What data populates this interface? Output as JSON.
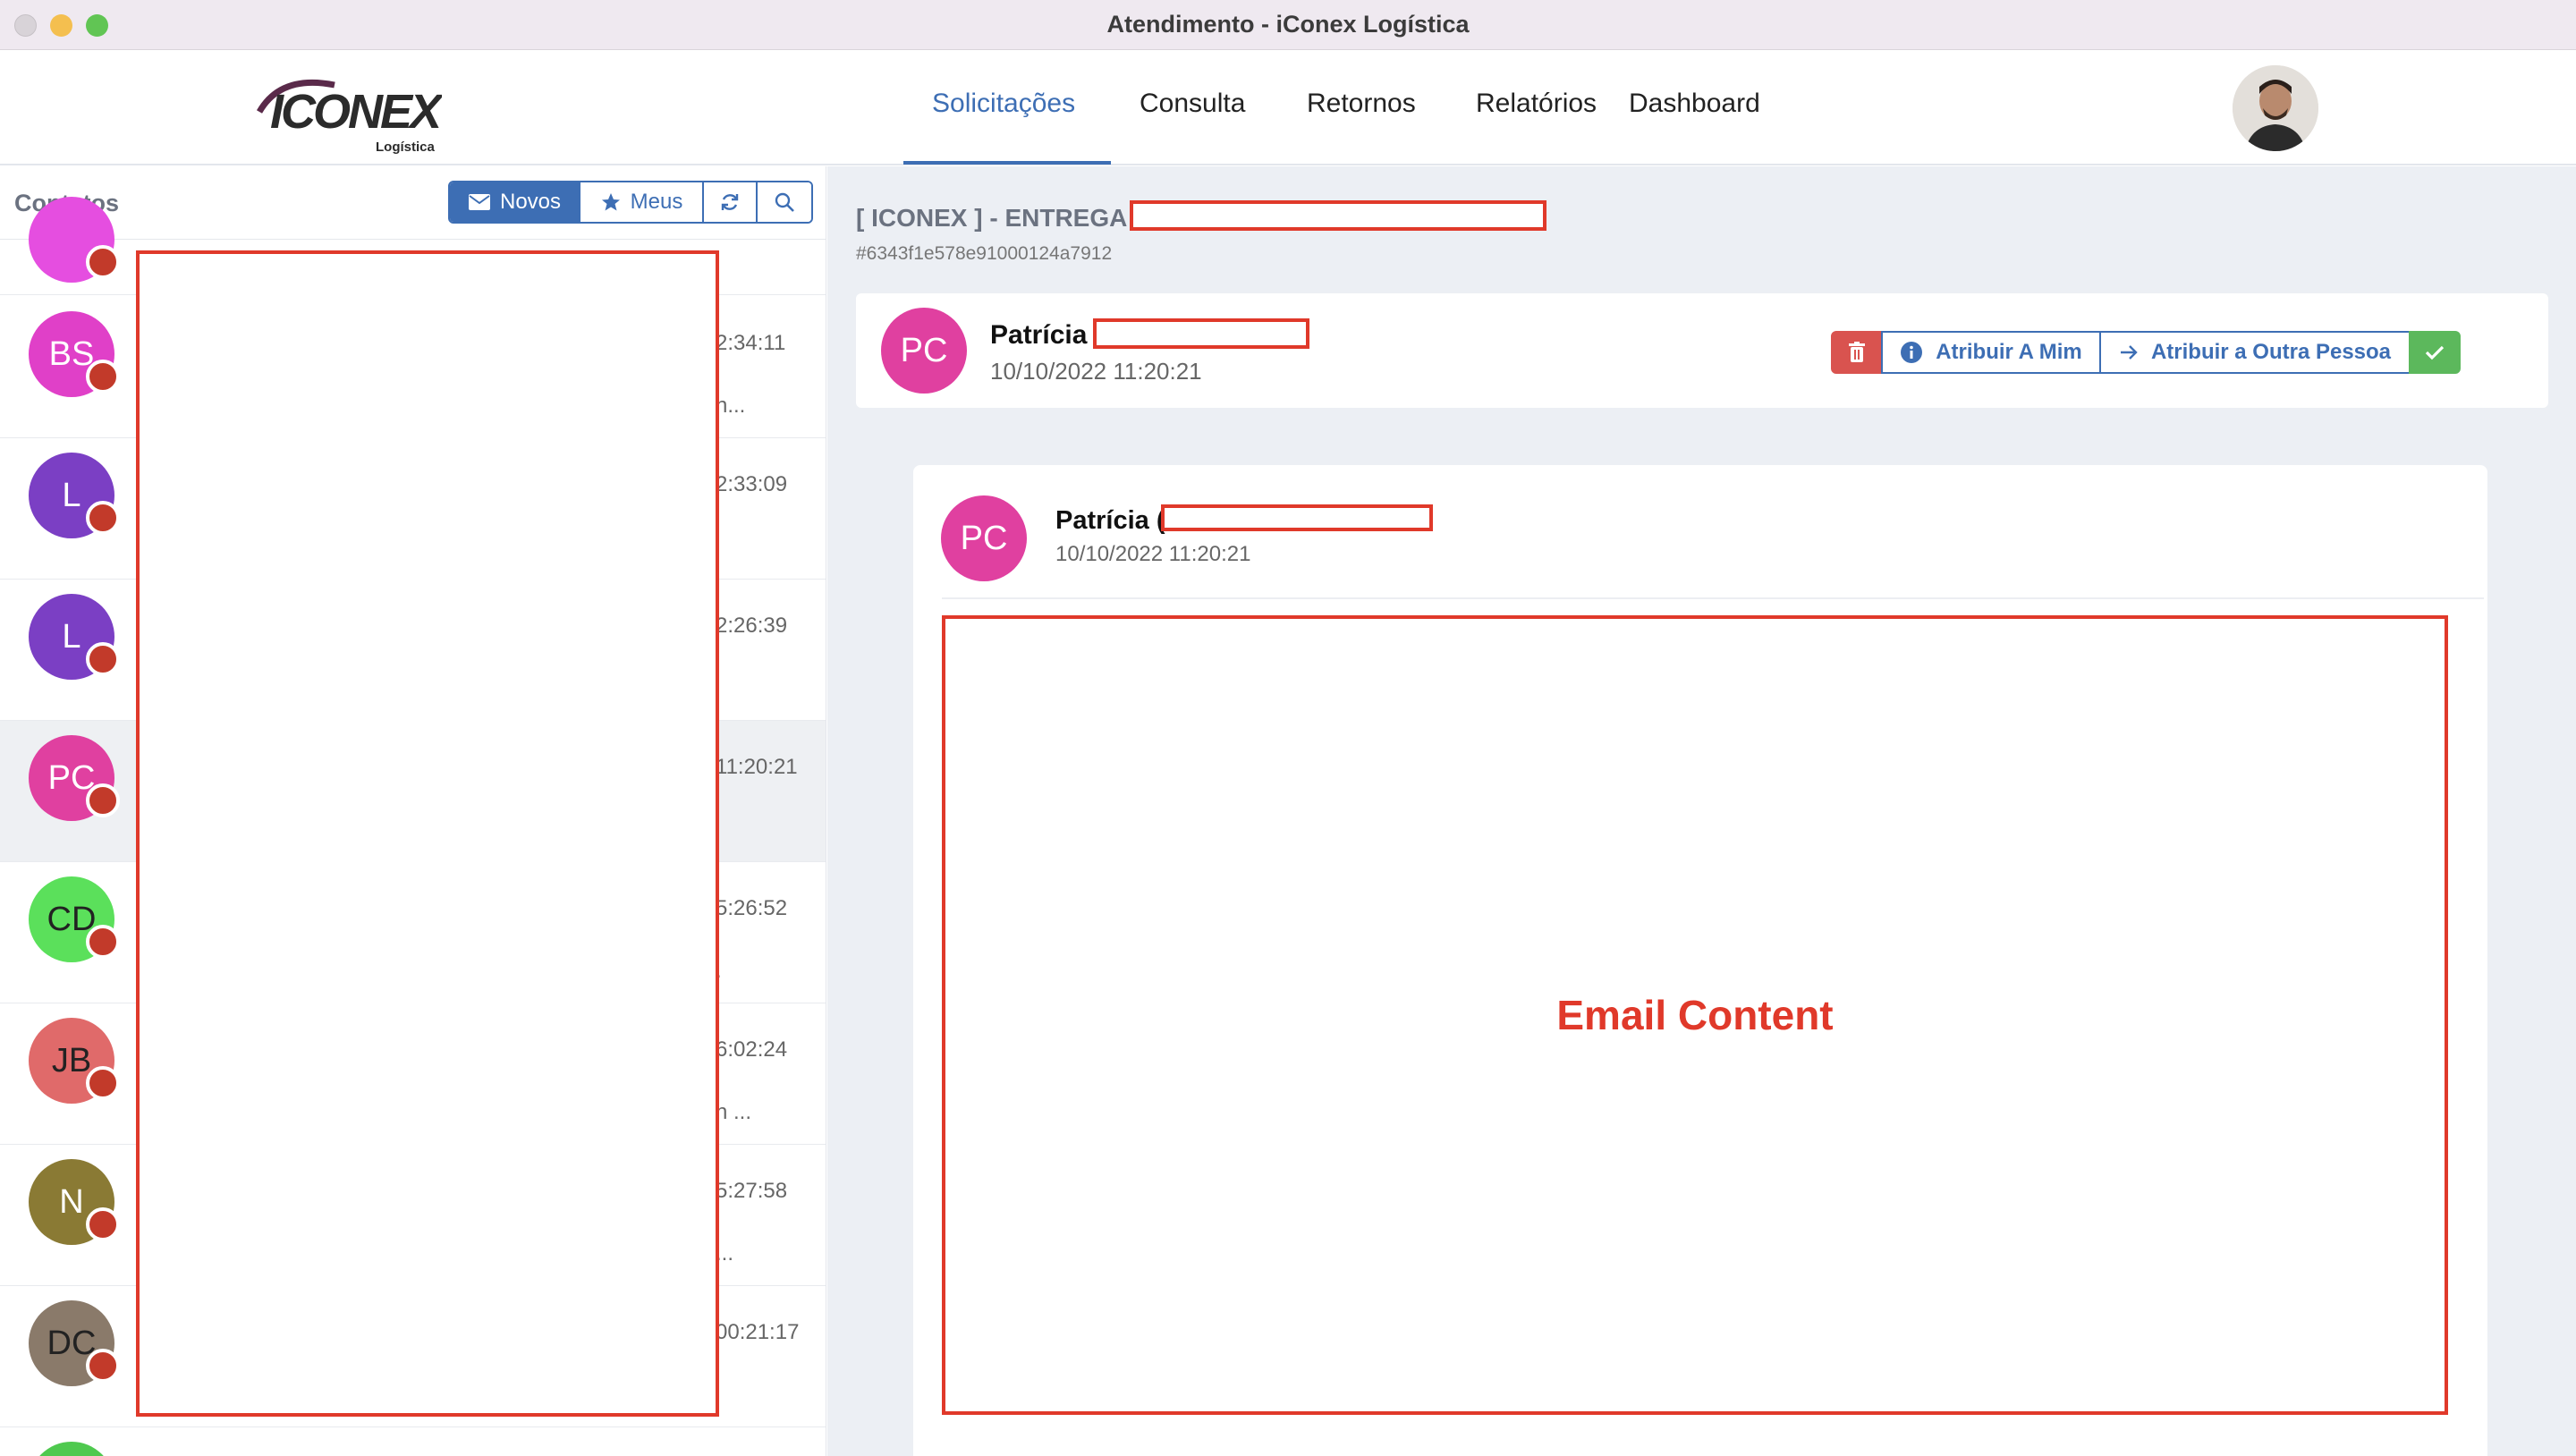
{
  "window": {
    "title": "Atendimento - iConex Logística"
  },
  "header": {
    "logo_text": "ICONEX",
    "logo_sub": "Logística",
    "nav": [
      "Solicitações",
      "Consulta",
      "Retornos",
      "Relatórios",
      "Dashboard"
    ],
    "active_nav": "Solicitações"
  },
  "sidebar": {
    "title": "Contatos",
    "buttons": {
      "new_label": "Novos",
      "mine_label": "Meus"
    },
    "contacts": [
      {
        "initials": "BS",
        "color": "#e040c8",
        "time": "2:34:11",
        "snippet": "n..."
      },
      {
        "initials": "L",
        "color": "#7b3fc4",
        "time": "2:33:09",
        "snippet": ""
      },
      {
        "initials": "L",
        "color": "#7b3fc4",
        "time": "2:26:39",
        "snippet": ""
      },
      {
        "initials": "PC",
        "color": "#e040a0",
        "time": "11:20:21",
        "snippet": ""
      },
      {
        "initials": "CD",
        "color": "#5be05b",
        "time": "5:26:52",
        "snippet": "."
      },
      {
        "initials": "JB",
        "color": "#e06a6a",
        "time": "6:02:24",
        "snippet": "n ..."
      },
      {
        "initials": "N",
        "color": "#8a7a34",
        "time": "5:27:58",
        "snippet": "..."
      },
      {
        "initials": "DC",
        "color": "#8a7a6a",
        "time": "00:21:17",
        "snippet": ""
      }
    ]
  },
  "main": {
    "subject": "[ ICONEX ] - ENTREGA",
    "message_id": "#6343f1e578e91000124a7912",
    "header_card": {
      "initials": "PC",
      "name": "Patrícia",
      "date": "10/10/2022 11:20:21"
    },
    "actions": {
      "assign_me": "Atribuir A Mim",
      "assign_other": "Atribuir a Outra Pessoa"
    },
    "message": {
      "initials": "PC",
      "name": "Patrícia (",
      "date": "10/10/2022 11:20:21",
      "content_label": "Email Content"
    }
  },
  "colors": {
    "accent": "#3d6eb4",
    "redaction": "#e0392a",
    "danger": "#d9534f",
    "success": "#5cb85c"
  }
}
